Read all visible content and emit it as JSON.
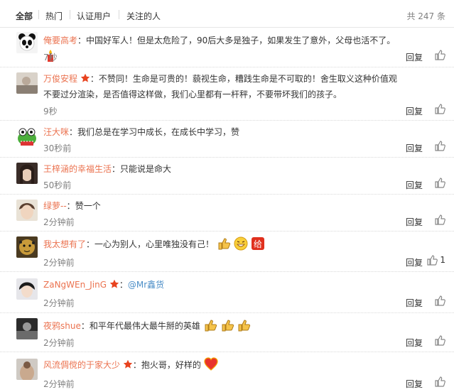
{
  "tabs": [
    "全部",
    "热门",
    "认证用户",
    "关注的人"
  ],
  "total": "共 247 条",
  "reply_label": "回复",
  "comments": [
    {
      "user": "俺要高考",
      "text": "中国好军人！但是太危险了，90后大多是独子，如果发生了意外，父母也活不了。",
      "time": "7秒"
    },
    {
      "user": "万俊安程",
      "text": "不赞同！生命是可贵的！藐视生命，糟践生命是不可取的！舍生取义这种价值观不要过分渲染，是否值得这样做，我们心里都有一杆秤，不要带坏我们的孩子。",
      "time": "9秒"
    },
    {
      "user": "汪大咪",
      "text": "我们总是在学习中成长，在成长中学习，赞",
      "time": "30秒前"
    },
    {
      "user": "王梓涵的幸福生活",
      "text": "只能说是命大",
      "time": "50秒前"
    },
    {
      "user": "绿萝--",
      "text": "赞一个",
      "time": "2分钟前"
    },
    {
      "user": "我太想有了",
      "text": "一心为别人，心里唯独没有己！",
      "time": "2分钟前",
      "like_count": "1"
    },
    {
      "user": "ZaNgWEn_JinG",
      "text": "@Mr鑫货",
      "time": "2分钟前"
    },
    {
      "user": "夜鸦shue",
      "text": "和平年代最伟大最牛掰的英雄",
      "time": "2分钟前"
    },
    {
      "user": "风流倜傥的于家大少",
      "text": "抱火哥，好样的",
      "time": "2分钟前"
    }
  ]
}
